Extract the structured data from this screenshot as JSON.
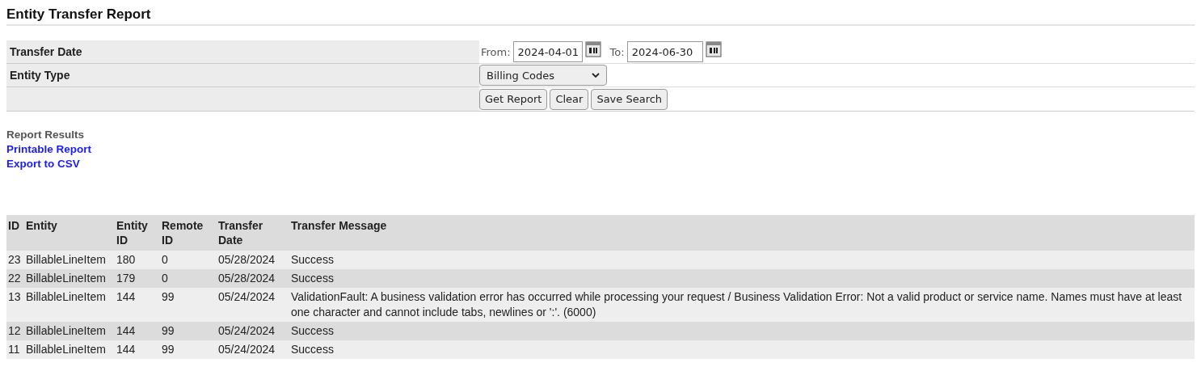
{
  "title": "Entity Transfer Report",
  "filters": {
    "transfer_date": {
      "label": "Transfer Date",
      "from_label": "From:",
      "from": "2024-04-01",
      "to_label": "To:",
      "to": "2024-06-30"
    },
    "entity_type": {
      "label": "Entity Type",
      "value": "Billing Codes"
    },
    "buttons": [
      "Get Report",
      "Clear",
      "Save Search"
    ]
  },
  "results": {
    "heading": "Report Results",
    "links": [
      "Printable Report",
      "Export to CSV"
    ]
  },
  "table": {
    "columns": [
      "ID",
      "Entity",
      "Entity ID",
      "Remote ID",
      "Transfer Date",
      "Transfer Message"
    ],
    "rows": [
      [
        "23",
        "BillableLineItem",
        "180",
        "0",
        "05/28/2024",
        "Success"
      ],
      [
        "22",
        "BillableLineItem",
        "179",
        "0",
        "05/28/2024",
        "Success"
      ],
      [
        "13",
        "BillableLineItem",
        "144",
        "99",
        "05/24/2024",
        "ValidationFault: A business validation error has occurred while processing your request / Business Validation Error: Not a valid product or service name. Names must have at least one character and cannot include tabs, newlines or ':'. (6000)"
      ],
      [
        "12",
        "BillableLineItem",
        "144",
        "99",
        "05/24/2024",
        "Success"
      ],
      [
        "11",
        "BillableLineItem",
        "144",
        "99",
        "05/24/2024",
        "Success"
      ]
    ]
  }
}
